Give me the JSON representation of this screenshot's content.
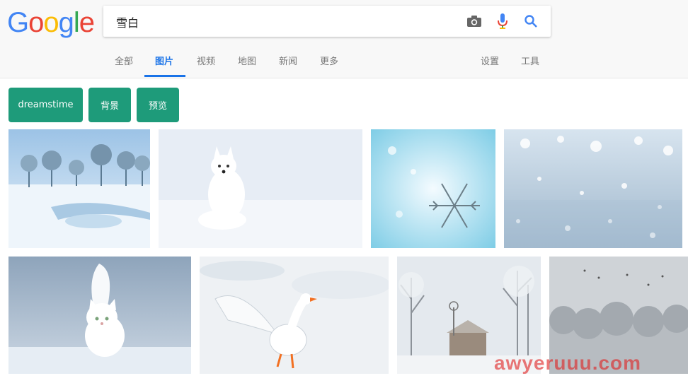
{
  "logo": {
    "letters": [
      "G",
      "o",
      "o",
      "g",
      "l",
      "e"
    ],
    "colors": [
      "#4285f4",
      "#ea4335",
      "#fbbc05",
      "#4285f4",
      "#34a853",
      "#ea4335"
    ]
  },
  "search": {
    "query": "雪白",
    "camera_icon": "camera-icon",
    "mic_icon": "microphone-icon",
    "search_icon": "search-icon"
  },
  "tabs": [
    {
      "label": "全部"
    },
    {
      "label": "图片",
      "active": true
    },
    {
      "label": "视频"
    },
    {
      "label": "地图"
    },
    {
      "label": "新闻"
    },
    {
      "label": "更多"
    }
  ],
  "right_tabs": {
    "settings": "设置",
    "tools": "工具"
  },
  "chips": [
    "dreamstime",
    "背景",
    "预览"
  ],
  "images": [
    {
      "name": "snowy-tree-landscape"
    },
    {
      "name": "arctic-fox"
    },
    {
      "name": "snowflake-on-blue"
    },
    {
      "name": "sparkling-snow-texture"
    },
    {
      "name": "white-cat-in-snow"
    },
    {
      "name": "white-goose-in-snow"
    },
    {
      "name": "snowy-farmhouse-windmill"
    },
    {
      "name": "frosted-forest-birds"
    }
  ],
  "watermark": "awyeruuu.com",
  "colors": {
    "accent": "#1a73e8",
    "chip": "#1e9b7a"
  }
}
